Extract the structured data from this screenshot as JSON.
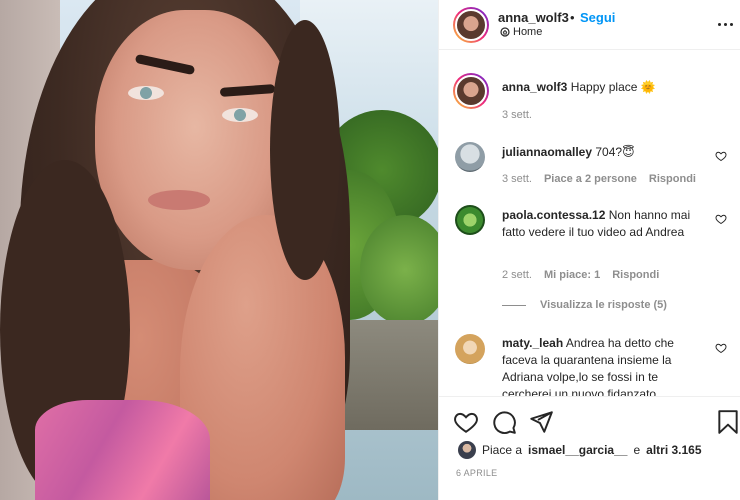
{
  "post": {
    "username": "anna_wolf3",
    "separator": "•",
    "follow_label": "Segui",
    "location": "Home",
    "caption_user": "anna_wolf3",
    "caption_text": "Happy place",
    "caption_emoji": "🌞",
    "caption_time": "3 sett."
  },
  "comments": [
    {
      "user": "juliannaomalley",
      "text": "704?😇",
      "time": "3 sett.",
      "likes": "Piace a 2 persone",
      "reply": "Rispondi"
    },
    {
      "user": "paola.contessa.12",
      "text": "Non hanno mai fatto vedere il tuo video ad Andrea",
      "time": "2 sett.",
      "likes": "Mi piace: 1",
      "reply": "Rispondi",
      "view_replies": "Visualizza le risposte (5)"
    },
    {
      "user": "maty._leah",
      "text": "Andrea ha detto che faceva la quarantena insieme la Adriana volpe,lo se fossi in te cercherei un nuovo fidanzato"
    }
  ],
  "footer": {
    "likes_prefix": "Piace a",
    "likes_user": "ismael__garcia__",
    "likes_suffix": "e",
    "likes_others": "altri 3.165",
    "date": "6 APRILE"
  },
  "icons": {
    "more": "more-options-icon",
    "location": "home-location-icon",
    "like": "heart-icon",
    "comment": "comment-icon",
    "share": "share-icon",
    "save": "bookmark-icon"
  }
}
